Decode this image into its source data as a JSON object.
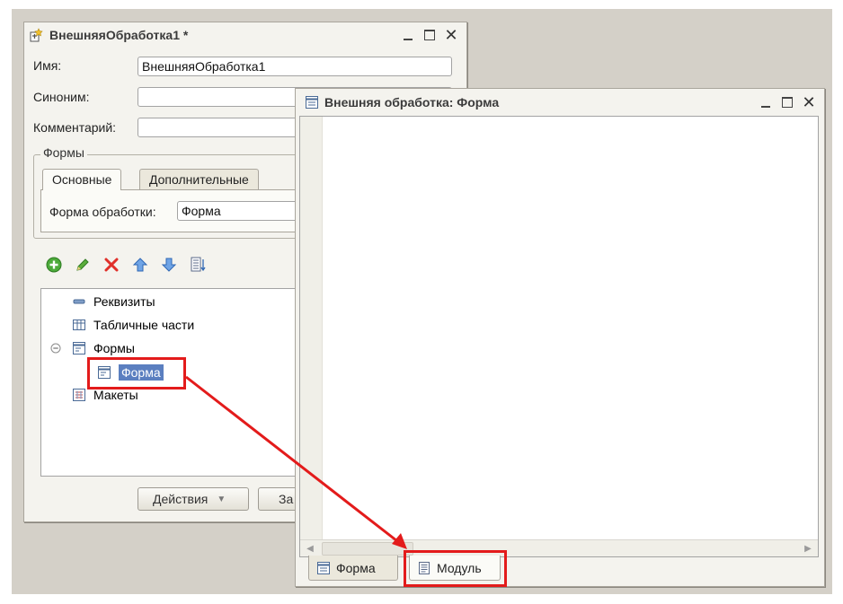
{
  "processing_window": {
    "title": "ВнешняяОбработка1 *",
    "name_label": "Имя:",
    "name_value": "ВнешняяОбработка1",
    "synonym_label": "Синоним:",
    "synonym_value": "",
    "comment_label": "Комментарий:",
    "comment_value": "",
    "forms_group_title": "Формы",
    "tabs": [
      {
        "label": "Основные",
        "active": true
      },
      {
        "label": "Дополнительные",
        "active": false
      }
    ],
    "processing_form_label": "Форма обработки:",
    "processing_form_value": "Форма",
    "toolbar_icons": [
      "add-icon",
      "edit-icon",
      "delete-icon",
      "move-up-icon",
      "move-down-icon",
      "sort-list-icon"
    ],
    "tree": [
      {
        "label": "Реквизиты",
        "icon": "attribute-icon"
      },
      {
        "label": "Табличные части",
        "icon": "table-parts-icon"
      },
      {
        "label": "Формы",
        "icon": "forms-icon",
        "expanded": true
      },
      {
        "label": "Форма",
        "icon": "form-icon",
        "selected": true
      },
      {
        "label": "Макеты",
        "icon": "templates-icon"
      }
    ],
    "actions_button": "Действия",
    "close_button_partial": "За"
  },
  "form_window": {
    "title": "Внешняя обработка: Форма",
    "bottom_tabs": [
      {
        "label": "Форма",
        "icon": "form-tab-icon",
        "active": false
      },
      {
        "label": "Модуль",
        "icon": "module-icon",
        "active": true
      }
    ]
  },
  "colors": {
    "highlight": "#e31b1b",
    "selection": "#5b7fc0",
    "window_bg": "#f4f3ee"
  }
}
